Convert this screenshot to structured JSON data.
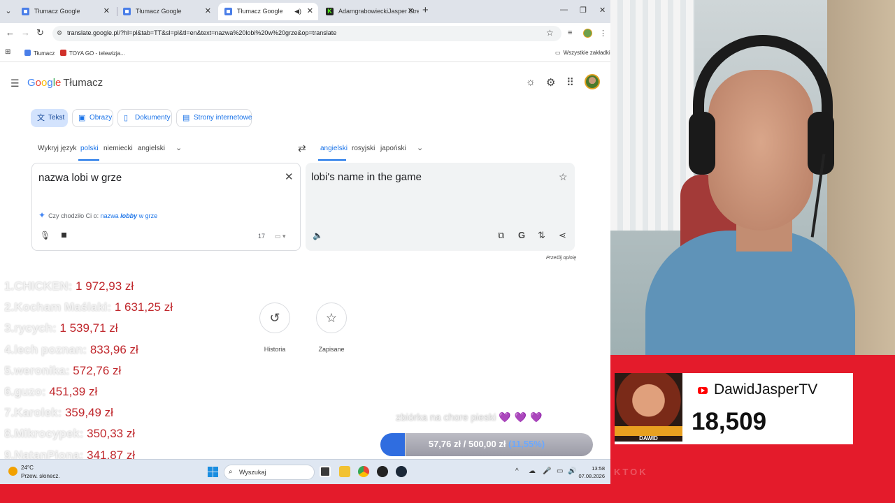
{
  "browser": {
    "tabs": [
      {
        "title": "Tłumacz Google",
        "favicon": "google-translate-icon"
      },
      {
        "title": "Tłumacz Google",
        "favicon": "google-translate-icon"
      },
      {
        "title": "Tłumacz Google",
        "favicon": "google-translate-icon",
        "active": true,
        "audio": true
      },
      {
        "title": "AdamgrabowieckiJasper Strea",
        "favicon": "kick-icon"
      }
    ],
    "url": "translate.google.pl/?hl=pl&tab=TT&sl=pl&tl=en&text=nazwa%20lobi%20w%20grze&op=translate",
    "bookmarks": [
      {
        "label": "Tłumacz",
        "icon": "google-translate-icon"
      },
      {
        "label": "TOYA GO - telewizja...",
        "icon": "toya-icon"
      }
    ],
    "all_bookmarks": "Wszystkie zakładki"
  },
  "translate": {
    "logo_google": [
      "G",
      "o",
      "o",
      "g",
      "l",
      "e"
    ],
    "product": "Tłumacz",
    "modes": [
      "Tekst",
      "Obrazy",
      "Dokumenty",
      "Strony internetowe"
    ],
    "source_langs": [
      "Wykryj język",
      "polski",
      "niemiecki",
      "angielski"
    ],
    "target_langs": [
      "angielski",
      "rosyjski",
      "japoński"
    ],
    "source_text": "nazwa lobi w grze",
    "suggestion_prefix": "Czy chodziło Ci o:",
    "suggestion_a": "nazwa",
    "suggestion_b": "lobby",
    "suggestion_c": "w grze",
    "char_count": "17",
    "target_text": "lobi's name in the game",
    "feedback": "Prześlij opinię",
    "history": "Historia",
    "saved": "Zapisane"
  },
  "overlay": {
    "leaderboard": [
      {
        "rank": "1.",
        "name": "CHICKEN",
        "amount": "1 972,93 zł"
      },
      {
        "rank": "2.",
        "name": "Kocham Maślaki",
        "amount": "1 631,25 zł"
      },
      {
        "rank": "3.",
        "name": "rycych",
        "amount": "1 539,71 zł"
      },
      {
        "rank": "4.",
        "name": "lech poznan",
        "amount": "833,96 zł"
      },
      {
        "rank": "5.",
        "name": "weronika",
        "amount": "572,76 zł"
      },
      {
        "rank": "6.",
        "name": "guzo",
        "amount": "451,39 zł"
      },
      {
        "rank": "7.",
        "name": "Karolek",
        "amount": "359,49 zł"
      },
      {
        "rank": "8.",
        "name": "Mikrocypek",
        "amount": "350,33 zł"
      },
      {
        "rank": "9.",
        "name": "NatanPiona",
        "amount": "341,87 zł"
      }
    ],
    "goal_title": "zbiórka na chore pieski",
    "goal_hearts": "💜💜💜",
    "goal_current": "57,76 zł",
    "goal_sep": "/",
    "goal_target": "500,00 zł",
    "goal_percent": "(11,55%)",
    "goal_fraction": 0.1155,
    "youtube_channel": "DawidJasperTV",
    "youtube_subs": "18,509",
    "thumb_text": "DAWID",
    "watermark": "KTOK"
  },
  "taskbar": {
    "temperature": "24°C",
    "weather": "Przew. słonecz.",
    "search": "Wyszukaj",
    "time": "13:58",
    "date": "07.08.2026"
  },
  "colors": {
    "accent_blue": "#1a73e8",
    "stream_red": "#e41b2b",
    "leader_amount": "#c0282d"
  }
}
